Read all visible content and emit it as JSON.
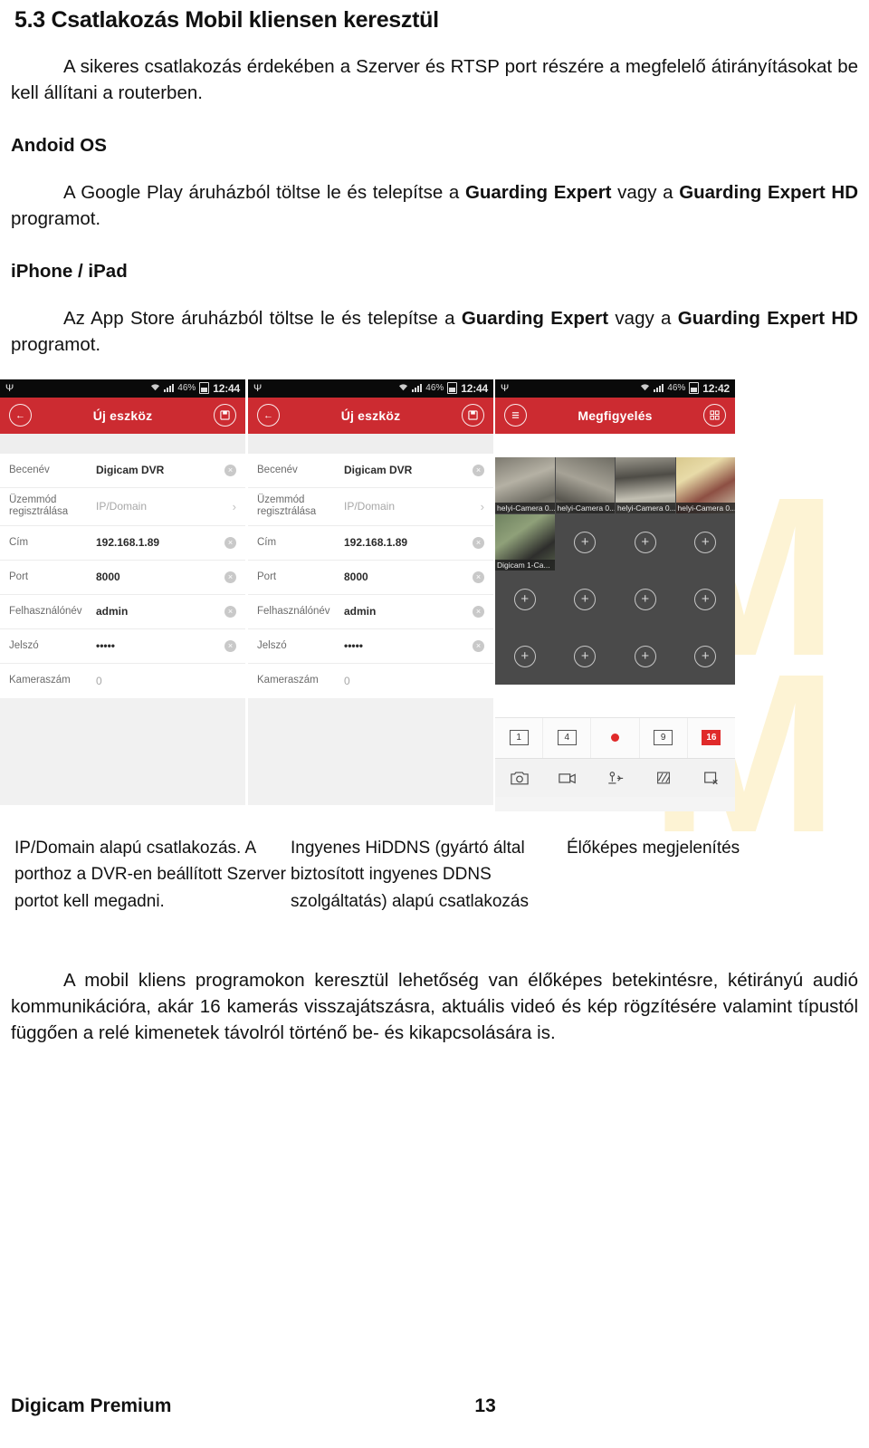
{
  "document": {
    "heading": "5.3 Csatlakozás Mobil kliensen keresztül",
    "intro": "A sikeres csatlakozás érdekében a Szerver és RTSP port részére a megfelelő átirányításokat be kell állítani a routerben.",
    "android": {
      "heading": "Andoid OS",
      "para_1": "A Google Play áruházból töltse le és telepítse a ",
      "bold_1": "Guarding Expert",
      "para_2": " vagy a ",
      "bold_2": "Guarding Expert HD",
      "para_3": " programot."
    },
    "ios": {
      "heading": "iPhone / iPad",
      "para_1": "Az App Store áruházból töltse le és telepítse a ",
      "bold_1": "Guarding Expert",
      "para_2": " vagy a ",
      "bold_2": "Guarding Expert HD",
      "para_3": " programot."
    },
    "closing": "A mobil kliens programokon keresztül lehetőség van élőképes betekintésre, kétirányú audió kommunikációra, akár 16 kamerás visszajátszásra, aktuális videó és kép rögzítésére valamint típustól függően a relé kimenetek távolról történő be- és kikapcsolására is.",
    "watermark": "M"
  },
  "footer": {
    "name": "Digicam Premium",
    "page": "13"
  },
  "captions": {
    "col1": "IP/Domain alapú csatlakozás. A porthoz a DVR-en beállított Szerver portot kell megadni.",
    "col2": "Ingyenes HiDDNS (gyártó által biztosított ingyenes DDNS szolgáltatás) alapú csatlakozás",
    "col3": "Élőképes megjelenítés"
  },
  "screenshot_a": {
    "statusbar": {
      "usb": "Ψ",
      "wifi": "wifi-icon",
      "signal": "signal-icon",
      "battery_percent": "46%",
      "time": "12:44"
    },
    "appbar": {
      "back": "←",
      "title": "Új eszköz",
      "save": "save-icon"
    },
    "fields": [
      {
        "label": "Becenév",
        "value": "Digicam DVR",
        "action": "clear"
      },
      {
        "label": "Üzemmód regisztrálása",
        "value": "IP/Domain",
        "action": "chevron",
        "muted": true
      },
      {
        "label": "Cím",
        "value": "192.168.1.89",
        "action": "clear"
      },
      {
        "label": "Port",
        "value": "8000",
        "action": "clear"
      },
      {
        "label": "Felhasználónév",
        "value": "admin",
        "action": "clear"
      },
      {
        "label": "Jelszó",
        "value": "•••••",
        "action": "clear"
      },
      {
        "label": "Kameraszám",
        "value": "0",
        "action": "none",
        "muted": true
      }
    ]
  },
  "screenshot_b": {
    "statusbar": {
      "usb": "Ψ",
      "wifi": "wifi-icon",
      "signal": "signal-icon",
      "battery_percent": "46%",
      "time": "12:44"
    },
    "appbar": {
      "back": "←",
      "title": "Új eszköz",
      "save": "save-icon"
    },
    "fields": [
      {
        "label": "Becenév",
        "value": "Digicam DVR",
        "action": "clear"
      },
      {
        "label": "Üzemmód regisztrálása",
        "value": "IP/Domain",
        "action": "chevron",
        "muted": true
      },
      {
        "label": "Cím",
        "value": "192.168.1.89",
        "action": "clear"
      },
      {
        "label": "Port",
        "value": "8000",
        "action": "clear"
      },
      {
        "label": "Felhasználónév",
        "value": "admin",
        "action": "clear"
      },
      {
        "label": "Jelszó",
        "value": "•••••",
        "action": "clear"
      },
      {
        "label": "Kameraszám",
        "value": "0",
        "action": "none",
        "muted": true
      }
    ]
  },
  "screenshot_c": {
    "statusbar": {
      "usb": "Ψ",
      "wifi": "wifi-icon",
      "signal": "signal-icon",
      "battery_percent": "46%",
      "time": "12:42"
    },
    "appbar": {
      "menu": "menu-icon",
      "title": "Megfigyelés",
      "action": "split-icon"
    },
    "cells": [
      {
        "caption": "helyi-Camera 0...",
        "live": true,
        "thumb": "thumb1"
      },
      {
        "caption": "helyi-Camera 0...",
        "live": true,
        "thumb": "thumb2"
      },
      {
        "caption": "helyi-Camera 0...",
        "live": true,
        "thumb": "thumb3"
      },
      {
        "caption": "helyi-Camera 0...",
        "live": true,
        "thumb": "thumb4"
      },
      {
        "caption": "Digicam 1-Ca...",
        "live": true,
        "thumb": "thumb5"
      },
      {
        "caption": "",
        "live": false
      },
      {
        "caption": "",
        "live": false
      },
      {
        "caption": "",
        "live": false
      },
      {
        "caption": "",
        "live": false
      },
      {
        "caption": "",
        "live": false
      },
      {
        "caption": "",
        "live": false
      },
      {
        "caption": "",
        "live": false
      },
      {
        "caption": "",
        "live": false
      },
      {
        "caption": "",
        "live": false
      },
      {
        "caption": "",
        "live": false
      },
      {
        "caption": "",
        "live": false
      }
    ],
    "layouts": [
      {
        "label": "1",
        "type": "box",
        "active": false
      },
      {
        "label": "4",
        "type": "box",
        "active": false
      },
      {
        "label": "",
        "type": "record",
        "active": false
      },
      {
        "label": "9",
        "type": "box",
        "active": false
      },
      {
        "label": "16",
        "type": "box",
        "active": true
      }
    ],
    "tools": [
      {
        "name": "capture-photo-icon"
      },
      {
        "name": "record-video-icon"
      },
      {
        "name": "ptz-joystick-icon"
      },
      {
        "name": "image-quality-icon"
      },
      {
        "name": "close-all-icon"
      }
    ]
  },
  "colors": {
    "app_red": "#cc2b31",
    "status_black": "#0a0a0a",
    "accent_record": "#e02a2a",
    "watermark": "#fdf3d4"
  }
}
